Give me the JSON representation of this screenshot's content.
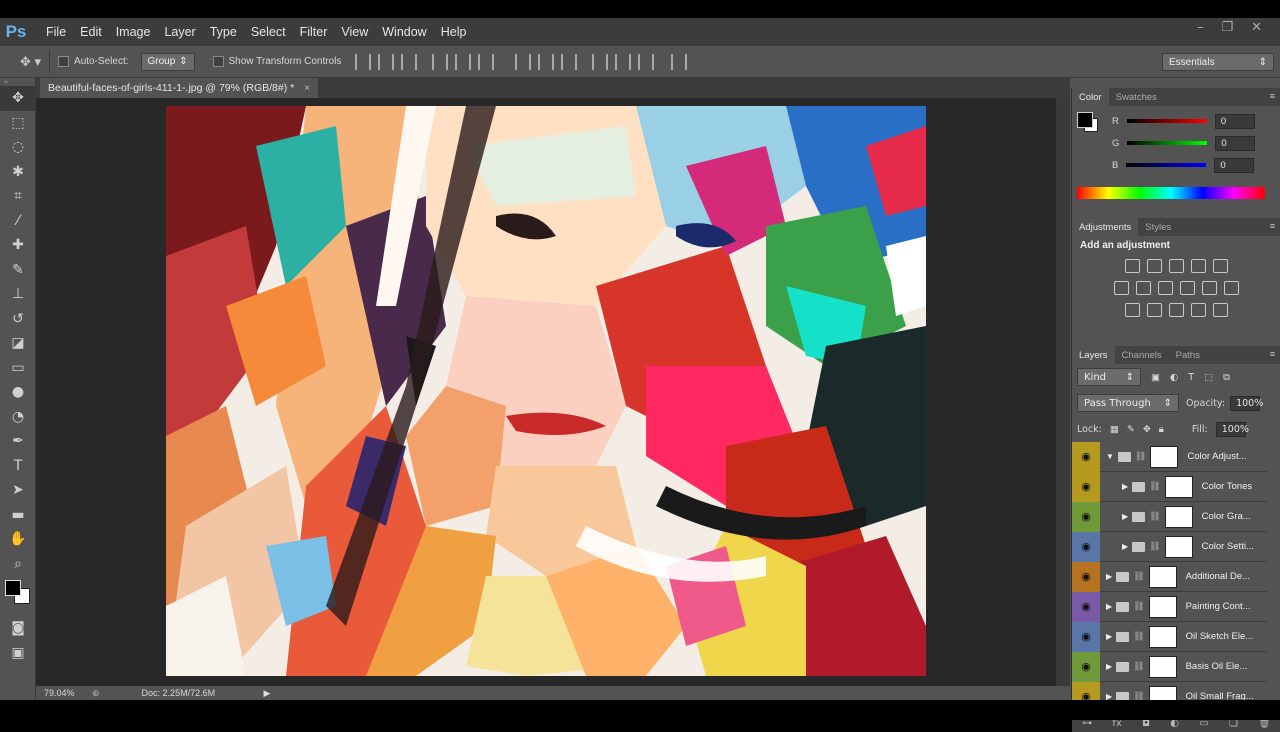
{
  "menubar": {
    "logo": "Ps",
    "items": [
      "File",
      "Edit",
      "Image",
      "Layer",
      "Type",
      "Select",
      "Filter",
      "View",
      "Window",
      "Help"
    ]
  },
  "options": {
    "auto_select_label": "Auto-Select:",
    "auto_select_value": "Group",
    "show_transform_label": "Show Transform Controls",
    "workspace": "Essentials"
  },
  "document": {
    "tab_title": "Beautiful-faces-of-girls-411-1-.jpg @ 79% (RGB/8#) *",
    "close": "×"
  },
  "status": {
    "zoom": "79.04%",
    "doc": "Doc: 2.25M/72.6M"
  },
  "color_panel": {
    "tabs": [
      "Color",
      "Swatches"
    ],
    "channels": [
      {
        "label": "R",
        "value": "0",
        "color": "#d22"
      },
      {
        "label": "G",
        "value": "0",
        "color": "#2c2"
      },
      {
        "label": "B",
        "value": "0",
        "color": "#22d"
      }
    ]
  },
  "adjustments_panel": {
    "tabs": [
      "Adjustments",
      "Styles"
    ],
    "heading": "Add an adjustment"
  },
  "layers_panel": {
    "tabs": [
      "Layers",
      "Channels",
      "Paths"
    ],
    "kind": "Kind",
    "blend_mode": "Pass Through",
    "opacity_label": "Opacity:",
    "opacity": "100%",
    "lock_label": "Lock:",
    "fill_label": "Fill:",
    "fill": "100%",
    "layers": [
      {
        "name": "Color Adjust...",
        "color": "#b59a1f",
        "indent": 0,
        "expanded": true
      },
      {
        "name": "Color Tones",
        "color": "#b59a1f",
        "indent": 1,
        "expanded": false
      },
      {
        "name": "Color Gra...",
        "color": "#6e9a3a",
        "indent": 1,
        "expanded": false
      },
      {
        "name": "Color Setti...",
        "color": "#5877a8",
        "indent": 1,
        "expanded": false
      },
      {
        "name": "Additional De...",
        "color": "#b5721f",
        "indent": 0,
        "expanded": false
      },
      {
        "name": "Painting Cont...",
        "color": "#7a5aa8",
        "indent": 0,
        "expanded": false
      },
      {
        "name": "Oil Sketch Ele...",
        "color": "#5877a8",
        "indent": 0,
        "expanded": false
      },
      {
        "name": "Basis Oil Ele...",
        "color": "#6e9a3a",
        "indent": 0,
        "expanded": false
      },
      {
        "name": "Oil Small Frag...",
        "color": "#b59a1f",
        "indent": 0,
        "expanded": false
      }
    ]
  },
  "tools": [
    "move-tool",
    "marquee-tool",
    "lasso-tool",
    "magic-wand-tool",
    "crop-tool",
    "eyedropper-tool",
    "healing-brush-tool",
    "brush-tool",
    "clone-stamp-tool",
    "history-brush-tool",
    "eraser-tool",
    "gradient-tool",
    "blur-tool",
    "dodge-tool",
    "pen-tool",
    "type-tool",
    "path-selection-tool",
    "rectangle-tool",
    "hand-tool",
    "zoom-tool"
  ]
}
